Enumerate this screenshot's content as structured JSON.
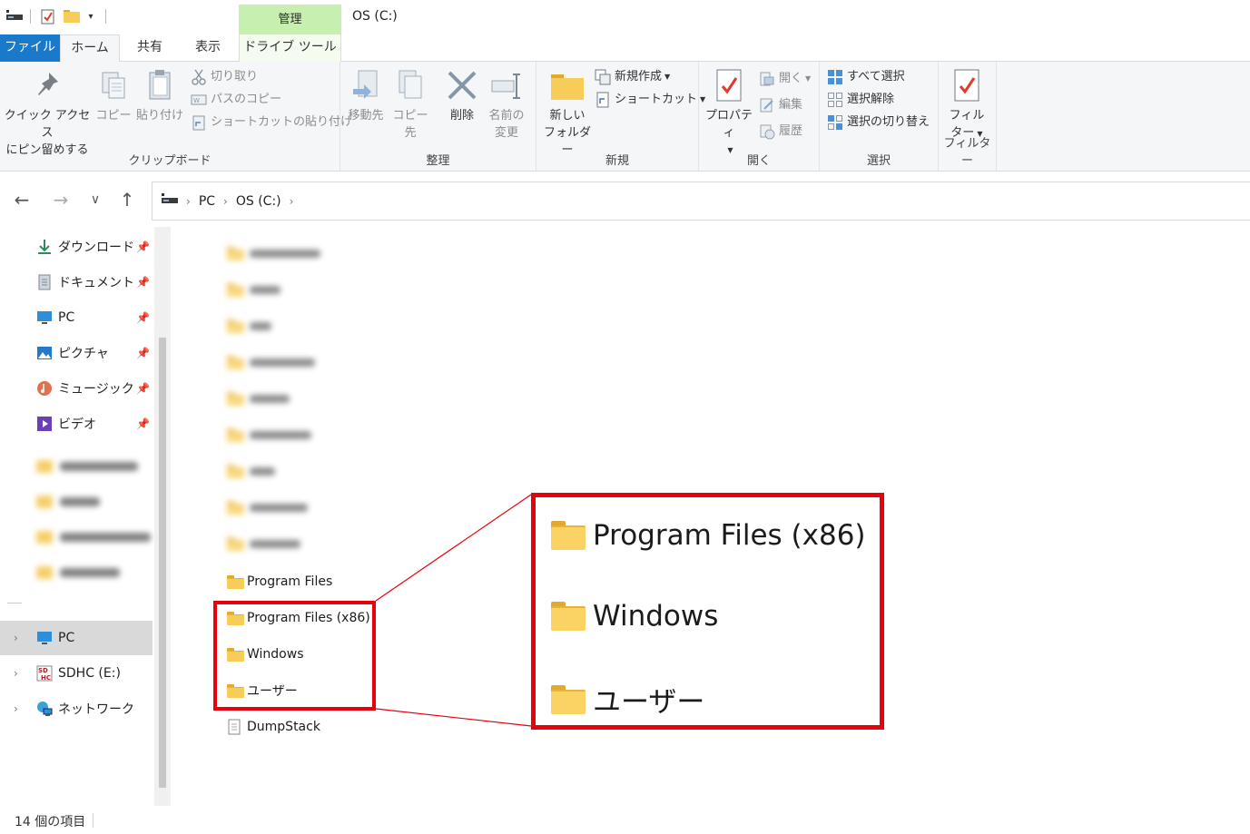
{
  "window": {
    "title": "OS (C:)",
    "context_tab": "管理"
  },
  "tabs": [
    {
      "label": "ファイル"
    },
    {
      "label": "ホーム"
    },
    {
      "label": "共有"
    },
    {
      "label": "表示"
    },
    {
      "label": "ドライブ ツール"
    }
  ],
  "ribbon": {
    "clipboard": {
      "label": "クリップボード",
      "pin_line1": "クイック アクセス",
      "pin_line2": "にピン留めする",
      "copy": "コピー",
      "paste": "貼り付け",
      "cut": "切り取り",
      "copy_path": "パスのコピー",
      "paste_shortcut": "ショートカットの貼り付け"
    },
    "organize": {
      "label": "整理",
      "move_to": "移動先",
      "copy_to": "コピー先",
      "delete": "削除",
      "rename_line1": "名前の",
      "rename_line2": "変更"
    },
    "new": {
      "label": "新規",
      "new_folder_line1": "新しい",
      "new_folder_line2": "フォルダー",
      "new_item": "新規作成",
      "shortcut": "ショートカット"
    },
    "open": {
      "label": "開く",
      "properties": "プロパティ",
      "open": "開く",
      "edit": "編集",
      "history": "履歴"
    },
    "select": {
      "label": "選択",
      "select_all": "すべて選択",
      "select_none": "選択解除",
      "invert": "選択の切り替え"
    },
    "filter": {
      "label": "フィルター",
      "btn_line1": "フィル",
      "btn_line2": "ター"
    }
  },
  "address": {
    "crumbs": [
      "PC",
      "OS (C:)"
    ]
  },
  "sidebar": {
    "quick_access": [
      {
        "label": "ダウンロード",
        "icon": "download-icon"
      },
      {
        "label": "ドキュメント",
        "icon": "document-icon"
      },
      {
        "label": "PC",
        "icon": "monitor-icon"
      },
      {
        "label": "ピクチャ",
        "icon": "picture-icon"
      },
      {
        "label": "ミュージック",
        "icon": "music-icon"
      },
      {
        "label": "ビデオ",
        "icon": "video-icon"
      }
    ],
    "tree": [
      {
        "label": "PC",
        "icon": "monitor-icon"
      },
      {
        "label": "SDHC (E:)",
        "icon": "sd-card-icon"
      },
      {
        "label": "ネットワーク",
        "icon": "network-icon"
      }
    ]
  },
  "files": {
    "visible": [
      {
        "name": "Program Files",
        "type": "folder"
      },
      {
        "name": "Program Files (x86)",
        "type": "folder"
      },
      {
        "name": "Windows",
        "type": "folder"
      },
      {
        "name": "ユーザー",
        "type": "folder"
      },
      {
        "name": "DumpStack",
        "type": "file"
      }
    ],
    "zoomed": [
      {
        "name": "Program Files (x86)"
      },
      {
        "name": "Windows"
      },
      {
        "name": "ユーザー"
      }
    ]
  },
  "status": {
    "item_count": "14 個の項目"
  },
  "colors": {
    "file_tab": "#1979ca",
    "context_tab": "#c6efb0",
    "highlight": "#e8000b",
    "folder": "#f7cc59"
  }
}
